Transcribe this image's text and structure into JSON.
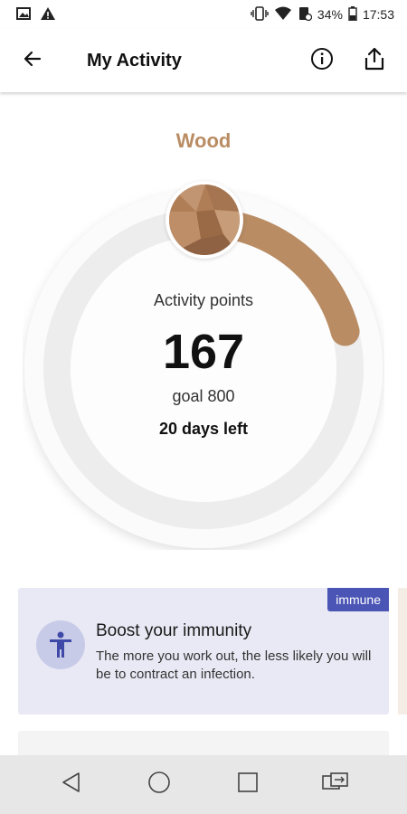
{
  "status_bar": {
    "battery": "34%",
    "time": "17:53",
    "icons": [
      "gallery-icon",
      "alert-icon",
      "vibrate-icon",
      "wifi-icon",
      "data-saver-icon",
      "battery-icon"
    ]
  },
  "app_bar": {
    "title": "My Activity",
    "back_icon": "arrow-left-icon",
    "info_icon": "info-icon",
    "share_icon": "share-icon"
  },
  "level": {
    "name": "Wood",
    "color": "#b98c63"
  },
  "progress": {
    "label": "Activity points",
    "points": "167",
    "goal_text": "goal 800",
    "days_left": "20 days left",
    "points_value": 167,
    "goal_value": 800,
    "arc_color": "#b98c63"
  },
  "card": {
    "tag": "immune",
    "title": "Boost your immunity",
    "body": "The more you work out, the less likely you will be to contract an infection.",
    "icon": "person-icon",
    "accent": "#4a55b5"
  },
  "nav_bar": {
    "buttons": [
      "back-triangle-icon",
      "home-circle-icon",
      "recents-square-icon",
      "screen-swap-icon"
    ]
  }
}
